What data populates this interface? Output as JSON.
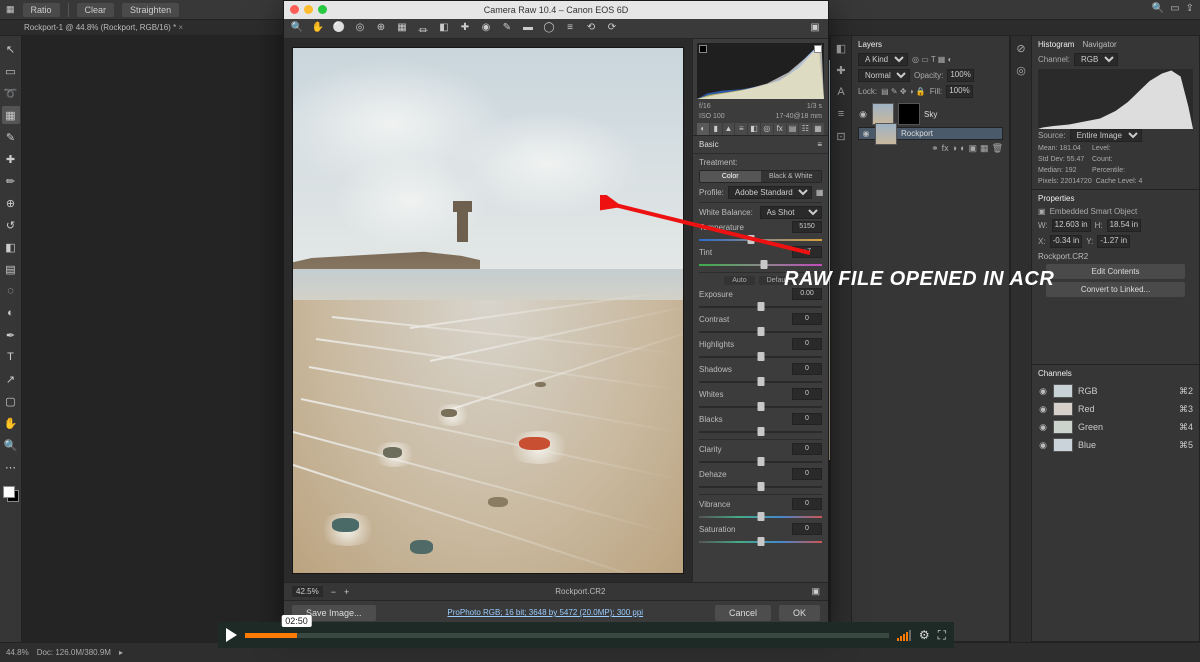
{
  "annotation": {
    "text": "RAW FILE OPENED IN ACR"
  },
  "ps": {
    "options": {
      "ratio_label": "Ratio",
      "clear": "Clear",
      "straighten": "Straighten"
    },
    "document_tab": "Rockport-1 @ 44.8% (Rockport, RGB/16) *",
    "status": {
      "zoom": "44.8%",
      "doc": "Doc: 126.0M/380.9M"
    },
    "tools": [
      "↖",
      "▦",
      "➤",
      "✂",
      "✎",
      "✦",
      "▲",
      "◌",
      "✚",
      "◧",
      "✶",
      "⌀",
      "◐",
      "T",
      "▭",
      "✥",
      "🔍",
      "⋯"
    ]
  },
  "layers_panel": {
    "tabs": [
      "Layers"
    ],
    "kind": "A Kind",
    "blend": "Normal",
    "opacity_label": "Opacity:",
    "opacity": "100%",
    "lock_label": "Lock:",
    "fill_label": "Fill:",
    "fill": "100%",
    "rows": [
      {
        "name": "Sky",
        "mask": true
      },
      {
        "name": "Rockport",
        "mask": false
      }
    ]
  },
  "histogram_panel": {
    "tabs": [
      "Histogram",
      "Navigator"
    ],
    "channel_label": "Channel:",
    "channel": "RGB",
    "source_label": "Source:",
    "source": "Entire Image",
    "stats": {
      "mean": "Mean:  181.04",
      "level": "Level:",
      "stddev": "Std Dev:  55.47",
      "count": "Count:",
      "median": "Median:  192",
      "percentile": "Percentile:",
      "pixels": "Pixels:  22014720",
      "cache": "Cache Level:  4"
    }
  },
  "properties_panel": {
    "title": "Properties",
    "kind": "Embedded Smart Object",
    "w_lbl": "W:",
    "w": "12.603 in",
    "h_lbl": "H:",
    "h": "18.54 in",
    "x_lbl": "X:",
    "x": "-0.34 in",
    "y_lbl": "Y:",
    "y": "-1.27 in",
    "file": "Rockport.CR2",
    "btn_edit": "Edit Contents",
    "btn_conv": "Convert to Linked..."
  },
  "channels_panel": {
    "title": "Channels",
    "items": [
      {
        "name": "RGB",
        "key": "⌘2",
        "color": "#c9d2d6"
      },
      {
        "name": "Red",
        "key": "⌘3",
        "color": "#d7cfc9"
      },
      {
        "name": "Green",
        "key": "⌘4",
        "color": "#ccd3cc"
      },
      {
        "name": "Blue",
        "key": "⌘5",
        "color": "#cbd3da"
      }
    ]
  },
  "acr": {
    "title": "Camera Raw 10.4  –  Canon EOS 6D",
    "tools": [
      "🔍",
      "✋",
      "⚪",
      "◧",
      "▦",
      "✂",
      "⏛",
      "⭯",
      "✔",
      "✎",
      "◌",
      "▽",
      "⋯",
      "⊕",
      "≡"
    ],
    "meta": {
      "fstop": "f/16",
      "shutter": "1/3 s",
      "iso": "ISO 100",
      "lens": "17-40@18 mm"
    },
    "panel_tabs": [
      "◐",
      "▮",
      "▲",
      "≡",
      "◧",
      "fx",
      "▤",
      "◑",
      "☷",
      "▦"
    ],
    "basic": {
      "header": "Basic",
      "treatment_label": "Treatment:",
      "treatment": [
        "Color",
        "Black & White"
      ],
      "profile_label": "Profile:",
      "profile": "Adobe Standard",
      "wb_label": "White Balance:",
      "wb": "As Shot",
      "temp_label": "Temperature",
      "temp_val": "5150",
      "tint_label": "Tint",
      "tint_val": "+7",
      "auto": "Auto",
      "default": "Default",
      "sliders": [
        {
          "label": "Exposure",
          "val": "0.00"
        },
        {
          "label": "Contrast",
          "val": "0"
        },
        {
          "label": "Highlights",
          "val": "0"
        },
        {
          "label": "Shadows",
          "val": "0"
        },
        {
          "label": "Whites",
          "val": "0"
        },
        {
          "label": "Blacks",
          "val": "0"
        }
      ],
      "sliders2": [
        {
          "label": "Clarity",
          "val": "0"
        },
        {
          "label": "Dehaze",
          "val": "0"
        }
      ],
      "sliders3": [
        {
          "label": "Vibrance",
          "val": "0"
        },
        {
          "label": "Saturation",
          "val": "0"
        }
      ]
    },
    "footer": {
      "zoom": "42.5%",
      "filename": "Rockport.CR2",
      "save": "Save Image...",
      "link": "ProPhoto RGB; 16 bit; 3648 by 5472 (20.0MP); 300 ppi",
      "cancel": "Cancel",
      "ok": "OK"
    }
  },
  "video": {
    "time": "02:50"
  }
}
